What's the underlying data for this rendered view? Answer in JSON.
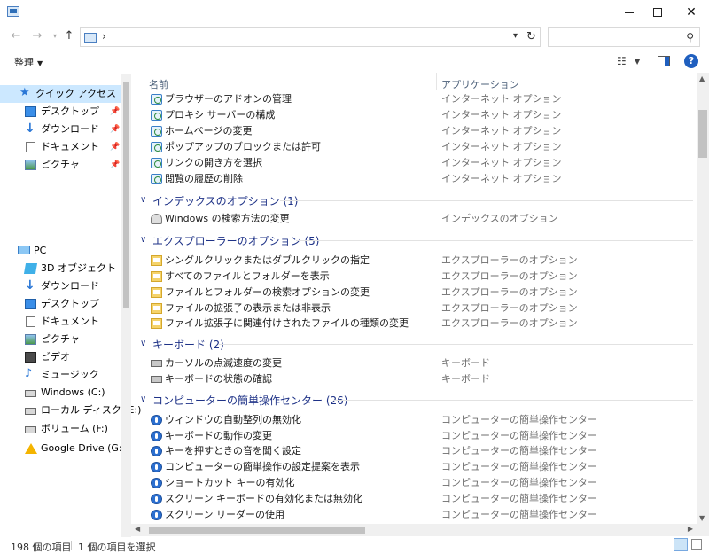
{
  "window": {
    "minimize_glyph": "",
    "close_glyph": "✕"
  },
  "address": {
    "chevron": "›",
    "value": ""
  },
  "search": {
    "placeholder": ""
  },
  "toolbar": {
    "organize_label": "整理",
    "organize_dropdown": "▼"
  },
  "nav": {
    "quick_access": {
      "label": "クイック アクセス",
      "items": [
        {
          "label": "デスクトップ",
          "icon": "desktop-icon",
          "pinned": true
        },
        {
          "label": "ダウンロード",
          "icon": "download-icon",
          "pinned": true
        },
        {
          "label": "ドキュメント",
          "icon": "document-icon",
          "pinned": true
        },
        {
          "label": "ピクチャ",
          "icon": "pictures-icon",
          "pinned": true
        }
      ]
    },
    "pc": {
      "label": "PC",
      "items": [
        {
          "label": "3D オブジェクト",
          "icon": "3d-objects-icon"
        },
        {
          "label": "ダウンロード",
          "icon": "download-icon"
        },
        {
          "label": "デスクトップ",
          "icon": "desktop-icon"
        },
        {
          "label": "ドキュメント",
          "icon": "document-icon"
        },
        {
          "label": "ピクチャ",
          "icon": "pictures-icon"
        },
        {
          "label": "ビデオ",
          "icon": "video-icon"
        },
        {
          "label": "ミュージック",
          "icon": "music-icon"
        },
        {
          "label": "Windows (C:)",
          "icon": "drive-icon"
        },
        {
          "label": "ローカル ディスク (E:)",
          "icon": "drive-icon"
        },
        {
          "label": "ボリューム (F:)",
          "icon": "drive-icon"
        },
        {
          "label": "Google Drive (G:)",
          "icon": "google-drive-icon"
        }
      ]
    }
  },
  "columns": {
    "name": "名前",
    "category": "アプリケーション"
  },
  "top_rows": [
    {
      "name": "ブラウザーのアドオンの管理",
      "category": "インターネット オプション"
    },
    {
      "name": "プロキシ サーバーの構成",
      "category": "インターネット オプション"
    },
    {
      "name": "ホームページの変更",
      "category": "インターネット オプション"
    },
    {
      "name": "ポップアップのブロックまたは許可",
      "category": "インターネット オプション"
    },
    {
      "name": "リンクの開き方を選択",
      "category": "インターネット オプション"
    },
    {
      "name": "閲覧の履歴の削除",
      "category": "インターネット オプション"
    }
  ],
  "groups": [
    {
      "title": "インデックスのオプション (1)",
      "icon": "search-options-icon",
      "rows": [
        {
          "name": "Windows の検索方法の変更",
          "category": "インデックスのオプション"
        }
      ]
    },
    {
      "title": "エクスプローラーのオプション (5)",
      "icon": "folder-options-icon",
      "rows": [
        {
          "name": "シングルクリックまたはダブルクリックの指定",
          "category": "エクスプローラーのオプション"
        },
        {
          "name": "すべてのファイルとフォルダーを表示",
          "category": "エクスプローラーのオプション"
        },
        {
          "name": "ファイルとフォルダーの検索オプションの変更",
          "category": "エクスプローラーのオプション"
        },
        {
          "name": "ファイルの拡張子の表示または非表示",
          "category": "エクスプローラーのオプション"
        },
        {
          "name": "ファイル拡張子に関連付けされたファイルの種類の変更",
          "category": "エクスプローラーのオプション"
        }
      ]
    },
    {
      "title": "キーボード (2)",
      "icon": "keyboard-icon",
      "rows": [
        {
          "name": "カーソルの点滅速度の変更",
          "category": "キーボード"
        },
        {
          "name": "キーボードの状態の確認",
          "category": "キーボード"
        }
      ]
    },
    {
      "title": "コンピューターの簡単操作センター (26)",
      "icon": "ease-of-access-icon",
      "rows": [
        {
          "name": "ウィンドウの自動整列の無効化",
          "category": "コンピューターの簡単操作センター"
        },
        {
          "name": "キーボードの動作の変更",
          "category": "コンピューターの簡単操作センター"
        },
        {
          "name": "キーを押すときの音を聞く設定",
          "category": "コンピューターの簡単操作センター"
        },
        {
          "name": "コンピューターの簡単操作の設定提案を表示",
          "category": "コンピューターの簡単操作センター"
        },
        {
          "name": "ショートカット キーの有効化",
          "category": "コンピューターの簡単操作センター"
        },
        {
          "name": "スクリーン キーボードの有効化または無効化",
          "category": "コンピューターの簡単操作センター"
        },
        {
          "name": "スクリーン リーダーの使用",
          "category": "コンピューターの簡単操作センター"
        }
      ]
    }
  ],
  "status": {
    "item_count": "198 個の項目",
    "selected": "1 個の項目を選択"
  },
  "colors": {
    "group_title": "#1e3287",
    "selection": "#cce8ff",
    "help": "#1f5fbf"
  }
}
